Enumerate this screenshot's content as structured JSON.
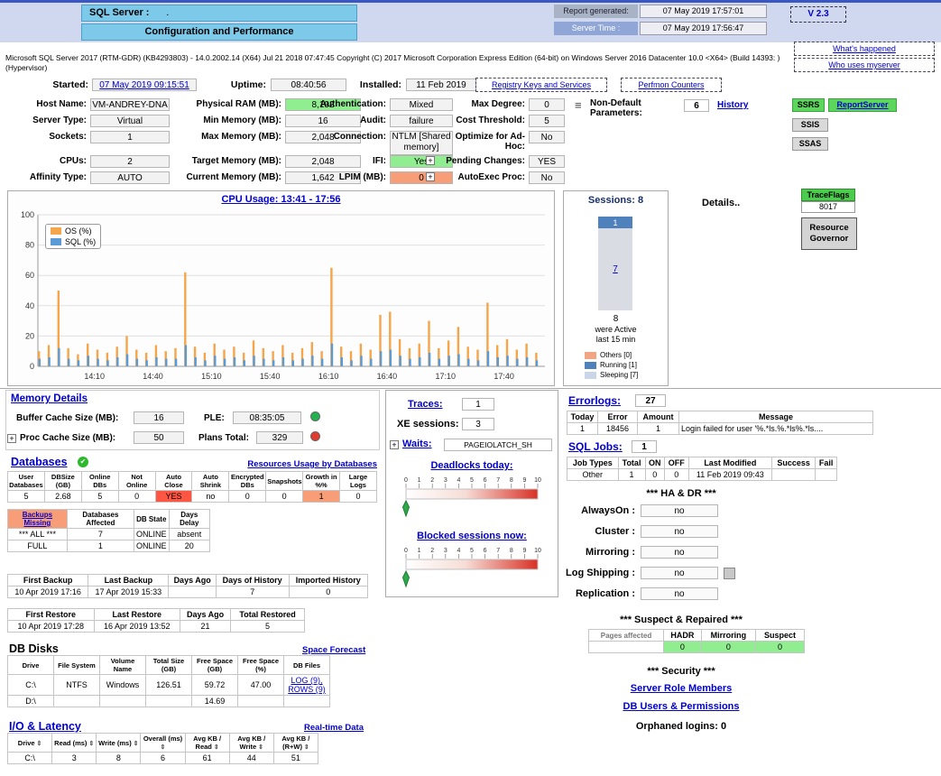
{
  "colors": {
    "cyan": "#7dc9ea",
    "band": "#cfd8ee",
    "green": "#90ee90",
    "salmon": "#f79e78",
    "red": "#ff5644",
    "link_blue": "#0000cc",
    "ple_dot_green": "#22b14c",
    "plans_dot_red": "#e23a2e",
    "gauge_red": "#d93025",
    "badge_green": "#5cd65c"
  },
  "header": {
    "server_label": "SQL Server :",
    "server_value": ".",
    "subtitle": "Configuration and Performance",
    "report_generated_label": "Report generated:",
    "report_generated_value": "07 May 2019 17:57:01",
    "server_time_label": "Server Time :",
    "server_time_value": "07 May 2019 17:56:47",
    "version_badge": "V 2.3",
    "whats_happened_link": "What's happened",
    "who_uses_link": "Who uses myserver",
    "version_text": "Microsoft SQL Server 2017 (RTM-GDR) (KB4293803) - 14.0.2002.14 (X64)   Jul 21 2018 07:47:45   Copyright (C) 2017 Microsoft Corporation  Express Edition (64-bit) on Windows Server 2016 Datacenter 10.0 <X64> (Build 14393: ) (Hypervisor)"
  },
  "uptime": {
    "started_label": "Started:",
    "started_value": "07 May 2019 09:15:51",
    "uptime_label": "Uptime:",
    "uptime_value": "08:40:56",
    "installed_label": "Installed:",
    "installed_value": "11 Feb 2019",
    "registry_button": "Registry Keys and Services",
    "perfmon_button": "Perfmon Counters"
  },
  "config": {
    "host_name_label": "Host Name:",
    "host_name": "VM-ANDREY-DNA",
    "server_type_label": "Server Type:",
    "server_type": "Virtual",
    "sockets_label": "Sockets:",
    "sockets": "1",
    "cpus_label": "CPUs:",
    "cpus": "2",
    "affinity_label": "Affinity Type:",
    "affinity": "AUTO",
    "physical_ram_label": "Physical RAM (MB):",
    "physical_ram": "8,192",
    "min_memory_label": "Min Memory (MB):",
    "min_memory": "16",
    "max_memory_label": "Max Memory (MB):",
    "max_memory": "2,048",
    "target_memory_label": "Target Memory (MB):",
    "target_memory": "2,048",
    "current_memory_label": "Current Memory (MB):",
    "current_memory": "1,642",
    "auth_label": "Authentication:",
    "auth": "Mixed",
    "audit_label": "Audit:",
    "audit": "failure",
    "connection_label": "Connection:",
    "connection": "NTLM [Shared memory]",
    "ifi_label": "IFI:",
    "ifi": "Yes",
    "lpim_label": "LPIM (MB):",
    "lpim": "0",
    "max_degree_label": "Max Degree:",
    "max_degree": "0",
    "cost_threshold_label": "Cost Threshold:",
    "cost_threshold": "5",
    "adhoc_label": "Optimize for Ad-Hoc:",
    "adhoc": "No",
    "pending_label": "Pending Changes:",
    "pending": "YES",
    "autoexec_label": "AutoExec Proc:",
    "autoexec": "No",
    "nondefault_label": "Non-Default Parameters:",
    "nondefault_count": "6",
    "history_link": "History",
    "ssrs": "SSRS",
    "reportserver": "ReportServer",
    "ssis": "SSIS",
    "ssas": "SSAS"
  },
  "chart_data": {
    "type": "bar",
    "title": "CPU Usage: 13:41 - 17:56",
    "xlabel": "",
    "ylabel": "",
    "ylim": [
      0,
      100
    ],
    "yticks": [
      0,
      20,
      40,
      60,
      80,
      100
    ],
    "grid": true,
    "legend_position": "top-left",
    "x_tick_labels": [
      "14:10",
      "14:40",
      "15:10",
      "15:40",
      "16:10",
      "16:40",
      "17:10",
      "17:40"
    ],
    "tick_positions": [
      5.8,
      11.8,
      17.8,
      23.8,
      29.8,
      35.8,
      41.8,
      47.8
    ],
    "series": [
      {
        "name": "OS (%)",
        "color": "#f5a54a",
        "values": [
          10,
          14,
          50,
          12,
          8,
          15,
          11,
          9,
          13,
          20,
          11,
          9,
          14,
          10,
          12,
          62,
          13,
          9,
          15,
          11,
          13,
          9,
          17,
          12,
          10,
          14,
          9,
          12,
          16,
          10,
          65,
          13,
          10,
          15,
          11,
          34,
          36,
          18,
          12,
          15,
          30,
          12,
          17,
          26,
          13,
          11,
          42,
          14,
          18,
          11,
          15,
          9
        ]
      },
      {
        "name": "SQL (%)",
        "color": "#5b9bd5",
        "values": [
          5,
          6,
          12,
          5,
          4,
          7,
          5,
          4,
          6,
          8,
          5,
          4,
          6,
          5,
          5,
          14,
          6,
          4,
          7,
          5,
          6,
          4,
          7,
          5,
          4,
          6,
          4,
          5,
          7,
          5,
          15,
          6,
          4,
          7,
          5,
          10,
          11,
          7,
          5,
          6,
          9,
          5,
          7,
          8,
          5,
          4,
          10,
          6,
          7,
          5,
          6,
          4
        ]
      }
    ]
  },
  "sessions": {
    "title": "Sessions: 8",
    "total_value": 8,
    "bar": [
      {
        "label": "1",
        "value": 1,
        "color": "#4f81bd"
      },
      {
        "label": "7",
        "value": 7,
        "color": "#d9dde3"
      }
    ],
    "total_label": "8",
    "caption_line1": "were Active",
    "caption_line2": "last 15 min",
    "legend": [
      {
        "label": "Others [0]",
        "color": "#f2a584"
      },
      {
        "label": "Running [1]",
        "color": "#4f81bd"
      },
      {
        "label": "Sleeping [7]",
        "color": "#c9d6e8"
      }
    ]
  },
  "details_label": "Details..",
  "traceflags": {
    "title": "TraceFlags",
    "value": "8017"
  },
  "resource_governor_label": "Resource Governor",
  "memory": {
    "title": "Memory Details",
    "buffer_label": "Buffer Cache Size (MB):",
    "buffer_value": "16",
    "ple_label": "PLE:",
    "ple_value": "08:35:05",
    "proc_label": "Proc Cache Size (MB):",
    "proc_value": "50",
    "plans_label": "Plans Total:",
    "plans_value": "329"
  },
  "databases": {
    "title": "Databases",
    "usage_link": "Resources Usage by Databases",
    "headers": [
      "User Databases",
      "DBSize (GB)",
      "Online DBs",
      "Not Online",
      "Auto Close",
      "Auto Shrink",
      "Encrypted DBs",
      "Snapshots",
      "Growth in %%",
      "Large Logs"
    ],
    "rows": [
      [
        "5",
        "2.68",
        "5",
        "0",
        {
          "t": "YES",
          "cls": "bg-red"
        },
        "no",
        "0",
        "0",
        {
          "t": "1",
          "cls": "bg-salmon"
        },
        "0"
      ]
    ]
  },
  "backups": {
    "headers": [
      {
        "t": "Backups Missing",
        "cls": "bg-salmon link",
        "link": true
      },
      "Databases Affected",
      "DB State",
      "Days Delay"
    ],
    "rows": [
      [
        "*** ALL ***",
        "7",
        "ONLINE",
        "absent"
      ],
      [
        "FULL",
        "1",
        "ONLINE",
        "20"
      ]
    ]
  },
  "backup_history": {
    "headers": [
      "First Backup",
      "Last Backup",
      "Days Ago",
      "Days of History",
      "Imported History"
    ],
    "rows": [
      [
        "10 Apr 2019 17:16",
        "17 Apr 2019 15:33",
        "",
        "7",
        "0"
      ]
    ]
  },
  "restores": {
    "headers": [
      "First Restore",
      "Last Restore",
      "Days Ago",
      "Total Restored"
    ],
    "rows": [
      [
        "10 Apr 2019 17:28",
        "16 Apr 2019 13:52",
        "21",
        "5"
      ]
    ]
  },
  "db_disks": {
    "title": "DB Disks",
    "forecast_link": "Space Forecast",
    "headers": [
      "Drive",
      "File System",
      "Volume Name",
      "Total Size (GB)",
      "Free Space (GB)",
      "Free Space (%)",
      "DB Files"
    ],
    "rows": [
      [
        "C:\\",
        "NTFS",
        "Windows",
        "126.51",
        "59.72",
        "47.00",
        {
          "t": "LOG (9), ROWS (9)",
          "cls": "link",
          "link": true
        }
      ],
      [
        "D:\\",
        "",
        "",
        "",
        "14.69",
        "",
        ""
      ]
    ]
  },
  "io": {
    "title": "I/O & Latency",
    "realtime_link": "Real-time Data",
    "headers": [
      "Drive",
      "Read (ms)",
      "Write (ms)",
      "Overall (ms)",
      "Avg KB / Read",
      "Avg KB / Write",
      "Avg KB / (R+W)"
    ],
    "rows": [
      [
        "C:\\",
        "3",
        "8",
        "6",
        "61",
        "44",
        "51"
      ]
    ]
  },
  "middle": {
    "traces_label": "Traces:",
    "traces_value": "1",
    "xe_label": "XE sessions:",
    "xe_value": "3",
    "waits_label": "Waits:",
    "waits_value": "PAGEIOLATCH_SH",
    "deadlocks_label": "Deadlocks today:",
    "blocked_label": "Blocked sessions now:"
  },
  "gauges": {
    "min": 0,
    "max": 10,
    "ticks": [
      0,
      1,
      2,
      3,
      4,
      5,
      6,
      7,
      8,
      9,
      10
    ],
    "deadlocks_value": 0,
    "blocked_value": 0
  },
  "errorlogs": {
    "title": "Errorlogs:",
    "count": "27",
    "headers": [
      "Today",
      "Error",
      "Amount",
      "Message"
    ],
    "rows": [
      [
        "1",
        "18456",
        "1",
        {
          "t": "Login failed for user '%.*ls.%.*ls%.*ls....",
          "cls": "left"
        }
      ]
    ]
  },
  "sql_jobs": {
    "title": "SQL Jobs:",
    "count": "1",
    "headers": [
      "Job Types",
      "Total",
      "ON",
      "OFF",
      "Last Modified",
      "Success",
      "Fail"
    ],
    "rows": [
      [
        "Other",
        "1",
        "0",
        "0",
        "11 Feb 2019 09:43",
        "",
        ""
      ]
    ]
  },
  "hadr": {
    "title": "*** HA & DR ***",
    "rows": [
      {
        "label": "AlwaysOn :",
        "value": "no"
      },
      {
        "label": "Cluster :",
        "value": "no"
      },
      {
        "label": "Mirroring :",
        "value": "no"
      },
      {
        "label": "Log Shipping :",
        "value": "no"
      },
      {
        "label": "Replication :",
        "value": "no"
      }
    ]
  },
  "suspect": {
    "title": "*** Suspect & Repaired ***",
    "headers": [
      {
        "t": "Pages affected",
        "cls": "muted"
      },
      "HADR",
      "Mirroring",
      "Suspect"
    ],
    "rows": [
      [
        "",
        {
          "t": "0",
          "cls": "bg-green"
        },
        {
          "t": "0",
          "cls": "bg-green"
        },
        {
          "t": "0",
          "cls": "bg-green"
        }
      ]
    ]
  },
  "security": {
    "title": "*** Security ***",
    "server_roles_link": "Server Role Members",
    "db_users_link": "DB Users & Permissions",
    "orphaned_label": "Orphaned logins: 0"
  }
}
